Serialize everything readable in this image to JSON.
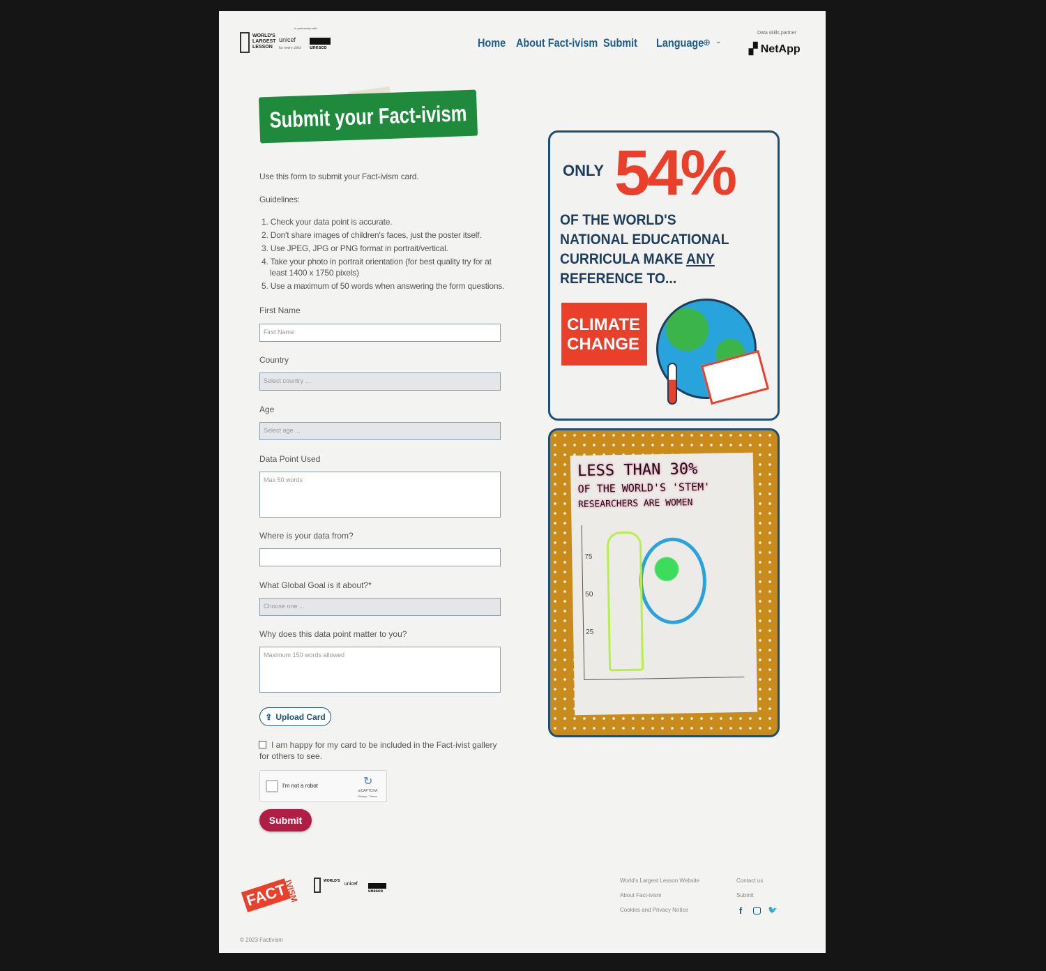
{
  "header": {
    "logo_lines": [
      "WORLD'S",
      "LARGEST",
      "LESSON"
    ],
    "partnership": "In partnership with",
    "unicef": "unicef",
    "unicef_tag": "for every child",
    "unesco": "unesco",
    "nav": [
      {
        "label": "Home"
      },
      {
        "label": "About Fact-ivism"
      },
      {
        "label": "Submit"
      },
      {
        "label": "Language"
      }
    ],
    "partner_label": "Data skills partner",
    "partner_name": "NetApp"
  },
  "main": {
    "title": "Submit your Fact-ivism",
    "intro": "Use this form to submit your Fact-ivism card.",
    "guidelines_label": "Guidelines:",
    "guidelines": [
      "1. Check your data point is accurate.",
      "2. Don't share images of children's faces, just the poster itself.",
      "3. Use JPEG, JPG or PNG format in portrait/vertical.",
      "4. Take your photo in portrait orientation (for best quality try for at",
      "least 1400 x 1750 pixels)",
      "5. Use a maximum of 50 words when answering the form questions."
    ],
    "fields": {
      "first_name": {
        "label": "First Name",
        "placeholder": "First Name"
      },
      "country": {
        "label": "Country",
        "placeholder": "Select country ..."
      },
      "age": {
        "label": "Age",
        "placeholder": "Select age ..."
      },
      "data_point": {
        "label": "Data Point Used",
        "placeholder": "Max 50 words"
      },
      "source": {
        "label": "Where is your data from?",
        "placeholder": ""
      },
      "goal": {
        "label": "What Global Goal is it about?*",
        "placeholder": "Choose one ..."
      },
      "why": {
        "label": "Why does this data point matter to you?",
        "placeholder": "Maximum 150 words allowed"
      }
    },
    "upload_label": "Upload Card",
    "consent": "I am happy for my card to be included in the Fact-ivist gallery for others to see.",
    "consent_checked": false,
    "recaptcha": {
      "label": "I'm not a robot",
      "brand": "reCAPTCHA",
      "links": "Privacy - Terms"
    },
    "submit_label": "Submit"
  },
  "cards": [
    {
      "only": "ONLY",
      "percent": "54%",
      "lines": [
        "OF THE WORLD'S",
        "NATIONAL EDUCATIONAL",
        "CURRICULA MAKE",
        "ANY",
        "REFERENCE TO..."
      ],
      "tag": [
        "CLIMATE",
        "CHANGE"
      ]
    },
    {
      "lines": [
        "LESS THAN 30%",
        "OF THE WORLD'S 'STEM'",
        "RESEARCHERS ARE WOMEN"
      ],
      "ticks": [
        "75",
        "50",
        "25"
      ]
    }
  ],
  "footer": {
    "brand": "FACT",
    "brand2": "IVISM",
    "links": [
      "World's Largest Lesson Website",
      "About Fact-ivism",
      "Cookies and Privacy Notice"
    ],
    "links2": [
      "Contact us",
      "Submit"
    ],
    "social": [
      "facebook-icon",
      "instagram-icon",
      "twitter-icon"
    ],
    "copyright": "© 2023 Factivism"
  },
  "colors": {
    "nav": "#1c5d8e",
    "title_bg": "#1f8a3c",
    "accent": "#e8402a",
    "submit": "#b01e45",
    "card_border": "#1d4f73"
  }
}
